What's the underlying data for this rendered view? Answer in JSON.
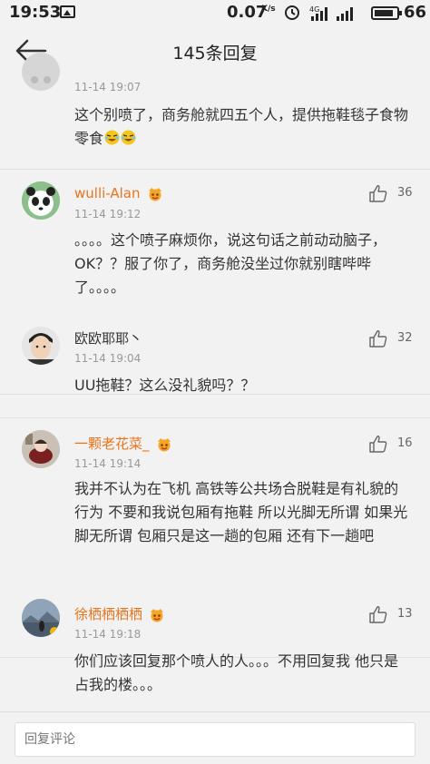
{
  "status_bar": {
    "time": "19:53",
    "net_speed": "0.07",
    "net_speed_unit": "K/s",
    "battery_percent": "66"
  },
  "header": {
    "title": "145条回复"
  },
  "comments": [
    {
      "username": "",
      "time": "11-14 19:07",
      "text": "这个别喷了，商务舱就四五个人，提供拖鞋毯子食物零食",
      "likes": "",
      "emoji_count": 2
    },
    {
      "username": "wulli-Alan",
      "time": "11-14 19:12",
      "text": "。。。。这个喷子麻烦你，说这句话之前动动脑子，OK？？服了你了，商务舱没坐过你就别瞎哔哔了。。。。",
      "likes": "36"
    },
    {
      "username": "欧欧耶耶丶",
      "time": "11-14 19:04",
      "text": "UU拖鞋？这么没礼貌吗？？",
      "likes": "32"
    },
    {
      "username": "一颗老花菜_",
      "time": "11-14 19:14",
      "text": "我并不认为在飞机 高铁等公共场合脱鞋是有礼貌的行为 不要和我说包厢有拖鞋 所以光脚无所谓 如果光脚无所谓 包厢只是这一趟的包厢 还有下一趟吧",
      "likes": "16"
    },
    {
      "username": "徐栖栖栖栖",
      "time": "11-14 19:18",
      "text": "你们应该回复那个喷人的人。。。不用回复我 他只是占我的楼。。。",
      "likes": "13"
    }
  ],
  "reply_bar": {
    "placeholder": "回复评论"
  },
  "colors": {
    "username_orange": "#e8741c",
    "background": "#f2f2f2",
    "timestamp_gray": "#999999"
  }
}
